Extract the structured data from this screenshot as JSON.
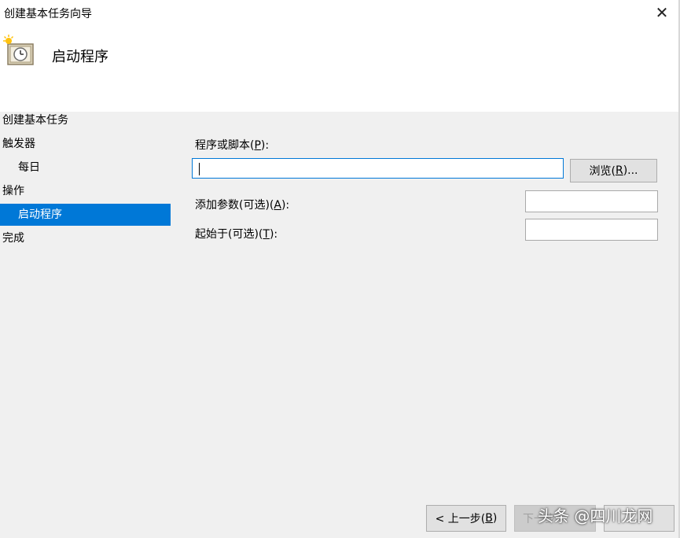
{
  "window": {
    "title": "创建基本任务向导",
    "close_glyph": "✕"
  },
  "header": {
    "title": "启动程序",
    "icon": "task-clock-icon"
  },
  "sidebar": {
    "items": [
      {
        "label": "创建基本任务"
      },
      {
        "label": "触发器"
      },
      {
        "label": "每日"
      },
      {
        "label": "操作"
      },
      {
        "label": "启动程序"
      },
      {
        "label": "完成"
      }
    ]
  },
  "form": {
    "program_label_prefix": "程序或脚本(",
    "program_label_key": "P",
    "program_label_suffix": "):",
    "program_value": "",
    "browse_prefix": "浏览(",
    "browse_key": "R",
    "browse_suffix": ")...",
    "args_label_prefix": "添加参数(可选)(",
    "args_label_key": "A",
    "args_label_suffix": "):",
    "args_value": "",
    "start_label_prefix": "起始于(可选)(",
    "start_label_key": "T",
    "start_label_suffix": "):",
    "start_value": ""
  },
  "footer": {
    "back_prefix": "< 上一步(",
    "back_key": "B",
    "back_suffix": ")",
    "next_label": "下一步"
  },
  "watermark": "头条 @四川龙网"
}
